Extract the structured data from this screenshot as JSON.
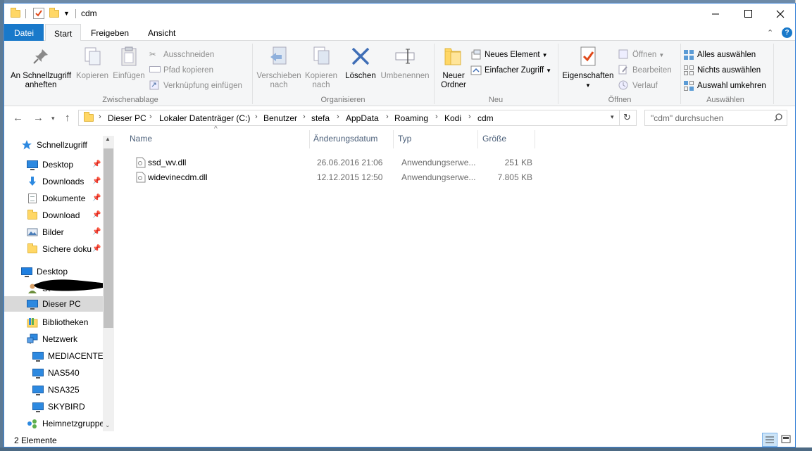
{
  "window": {
    "title": "cdm"
  },
  "ribbon_tabs": {
    "file": "Datei",
    "start": "Start",
    "share": "Freigeben",
    "view": "Ansicht"
  },
  "ribbon": {
    "clipboard": {
      "pin": "An Schnellzugriff anheften",
      "copy": "Kopieren",
      "paste": "Einfügen",
      "cut": "Ausschneiden",
      "copy_path": "Pfad kopieren",
      "paste_shortcut": "Verknüpfung einfügen",
      "label": "Zwischenablage"
    },
    "organize": {
      "move_to": "Verschieben nach",
      "copy_to": "Kopieren nach",
      "delete": "Löschen",
      "rename": "Umbenennen",
      "label": "Organisieren"
    },
    "new": {
      "new_folder": "Neuer Ordner",
      "new_item": "Neues Element",
      "easy_access": "Einfacher Zugriff",
      "label": "Neu"
    },
    "open": {
      "properties": "Eigenschaften",
      "open": "Öffnen",
      "edit": "Bearbeiten",
      "history": "Verlauf",
      "label": "Öffnen"
    },
    "select": {
      "select_all": "Alles auswählen",
      "select_none": "Nichts auswählen",
      "invert": "Auswahl umkehren",
      "label": "Auswählen"
    }
  },
  "address": {
    "crumbs": [
      "Dieser PC",
      "Lokaler Datenträger (C:)",
      "Benutzer",
      "stefa",
      "AppData",
      "Roaming",
      "Kodi",
      "cdm"
    ],
    "search_placeholder": "\"cdm\" durchsuchen"
  },
  "nav": {
    "quick_access": "Schnellzugriff",
    "items": [
      {
        "label": "Desktop",
        "pinned": true
      },
      {
        "label": "Downloads",
        "pinned": true
      },
      {
        "label": "Dokumente",
        "pinned": true
      },
      {
        "label": "Download",
        "pinned": true
      },
      {
        "label": "Bilder",
        "pinned": true
      },
      {
        "label": "Sichere dokumente",
        "pinned": true
      }
    ],
    "desktop": "Desktop",
    "user": "St",
    "this_pc": "Dieser PC",
    "libraries": "Bibliotheken",
    "network": "Netzwerk",
    "network_items": [
      "MEDIACENTER",
      "NAS540",
      "NSA325",
      "SKYBIRD"
    ],
    "homegroup": "Heimnetzgruppe"
  },
  "columns": {
    "name": "Name",
    "modified": "Änderungsdatum",
    "type": "Typ",
    "size": "Größe"
  },
  "files": [
    {
      "name": "ssd_wv.dll",
      "modified": "26.06.2016 21:06",
      "type": "Anwendungserwe...",
      "size": "251 KB"
    },
    {
      "name": "widevinecdm.dll",
      "modified": "12.12.2015 12:50",
      "type": "Anwendungserwe...",
      "size": "7.805 KB"
    }
  ],
  "status": {
    "count": "2 Elemente"
  },
  "colors": {
    "accent": "#1979ca",
    "folder": "#ffd766",
    "selection": "#d9d9d9"
  }
}
